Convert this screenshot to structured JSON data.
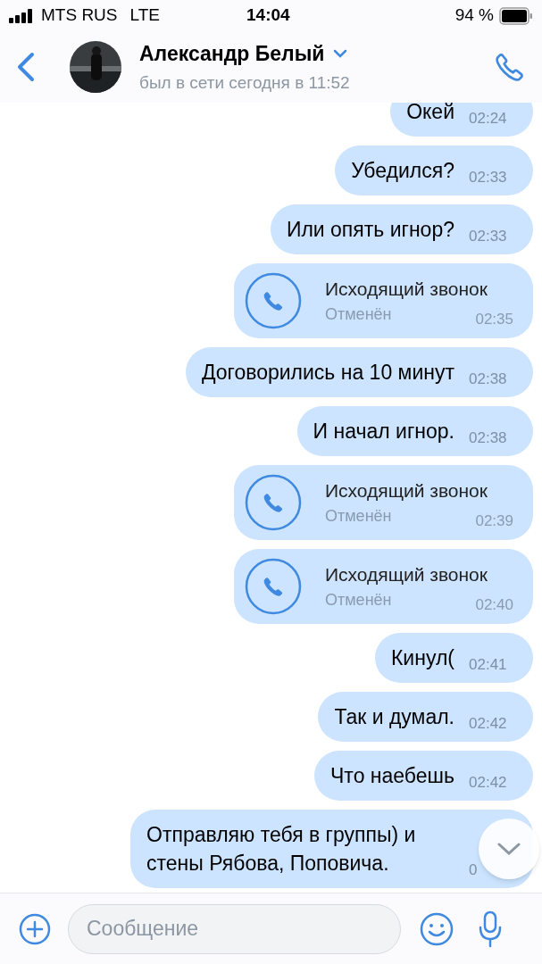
{
  "status_bar": {
    "carrier": "MTS RUS",
    "network": "LTE",
    "time": "14:04",
    "battery": "94 %"
  },
  "header": {
    "name": "Александр Белый",
    "status": "был в сети сегодня в 11:52"
  },
  "messages": [
    {
      "kind": "text",
      "text": "Окей",
      "time": "02:24"
    },
    {
      "kind": "text",
      "text": "Убедился?",
      "time": "02:33"
    },
    {
      "kind": "text",
      "text": "Или опять игнор?",
      "time": "02:33"
    },
    {
      "kind": "call",
      "title": "Исходящий звонок",
      "subtitle": "Отменён",
      "time": "02:35"
    },
    {
      "kind": "text",
      "text": "Договорились на 10 минут",
      "time": "02:38"
    },
    {
      "kind": "text",
      "text": "И начал игнор.",
      "time": "02:38"
    },
    {
      "kind": "call",
      "title": "Исходящий звонок",
      "subtitle": "Отменён",
      "time": "02:39"
    },
    {
      "kind": "call",
      "title": "Исходящий звонок",
      "subtitle": "Отменён",
      "time": "02:40"
    },
    {
      "kind": "text",
      "text": "Кинул(",
      "time": "02:41"
    },
    {
      "kind": "text",
      "text": "Так и думал.",
      "time": "02:42"
    },
    {
      "kind": "text",
      "text": "Что наебешь",
      "time": "02:42"
    },
    {
      "kind": "text",
      "text": "Отправляю тебя в группы) и стены Рябова, Поповича.",
      "time": "0"
    }
  ],
  "composer": {
    "placeholder": "Сообщение"
  }
}
